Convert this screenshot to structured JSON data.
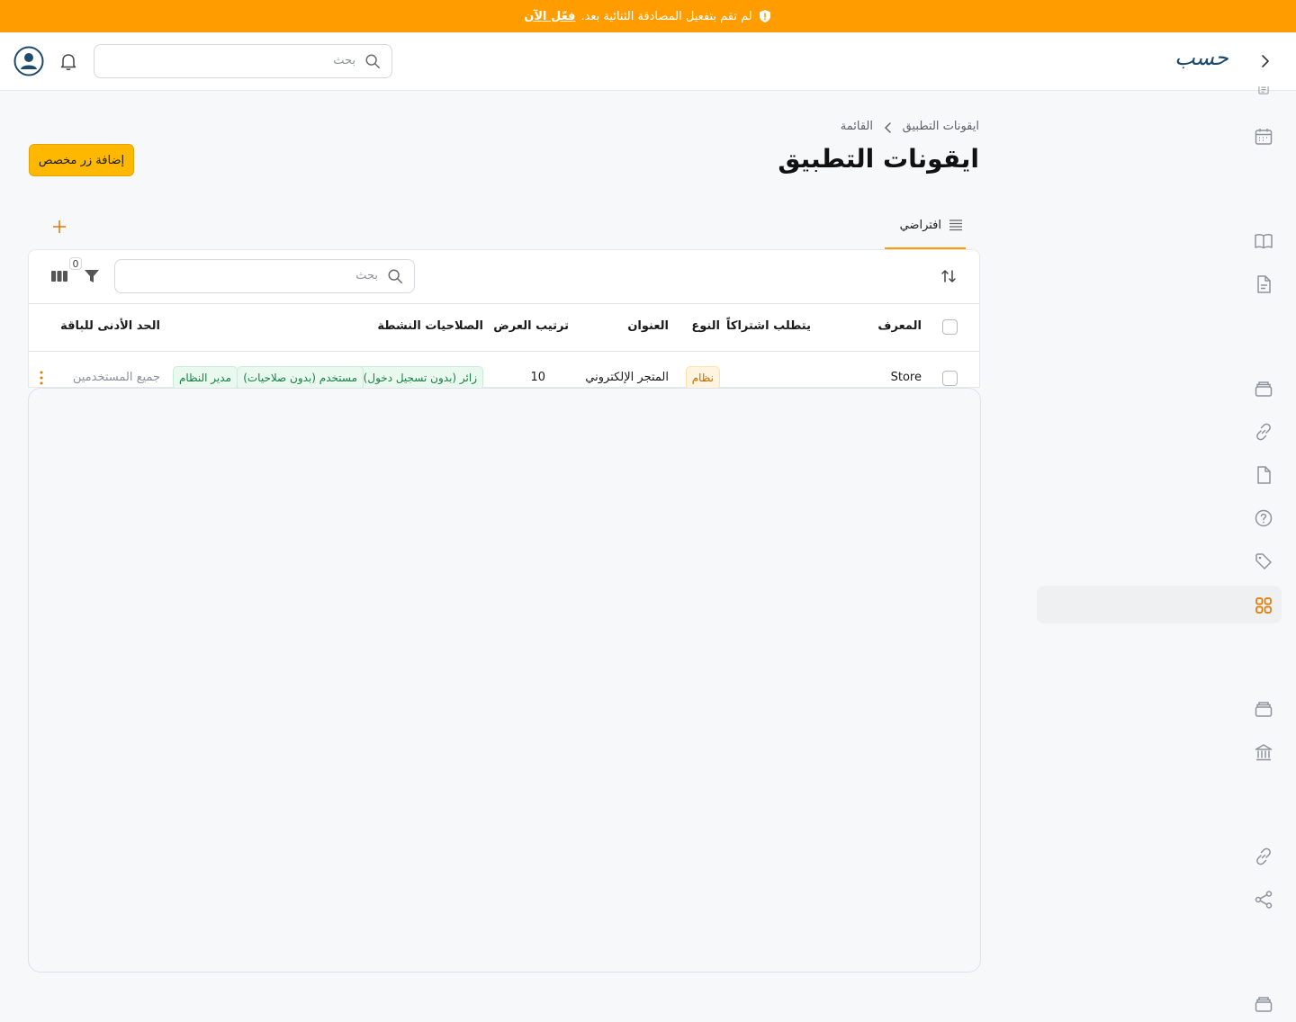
{
  "banner": {
    "text": "لم تقم بتفعيل المصادقة الثنائية بعد.",
    "link": "فعّل الآن"
  },
  "header": {
    "logo_text": "حسب",
    "search_placeholder": "بحث"
  },
  "breadcrumb": {
    "parent": "القائمة",
    "current": "ايقونات التطبيق"
  },
  "page": {
    "title": "ايقونات التطبيق",
    "add_button": "إضافة زر مخصص"
  },
  "tabs": [
    {
      "label": "افتراضي"
    }
  ],
  "toolbar": {
    "search_placeholder": "بحث",
    "filter_count": "0"
  },
  "table": {
    "columns": [
      "المعرف",
      "يتطلب اشتراكاً",
      "النوع",
      "العنوان",
      "ترتيب العرض",
      "الصلاحيات النشطة",
      "الحد الأدنى للباقة"
    ],
    "rows": [
      {
        "id": "Store",
        "requires_subscription": "",
        "type": "نظام",
        "title": "المتجر الإلكتروني",
        "display_order": "10",
        "permissions": [
          "زائر (بدون تسجيل دخول)",
          "مستخدم (بدون صلاحيات)",
          "مدير النظام"
        ],
        "min_plan": "جميع المستخدمين"
      }
    ]
  },
  "colors": {
    "accent": "#ff9d00",
    "primary_button": "#ffb800",
    "badge_green_text": "#1b7f43",
    "badge_orange_text": "#c46b00"
  }
}
